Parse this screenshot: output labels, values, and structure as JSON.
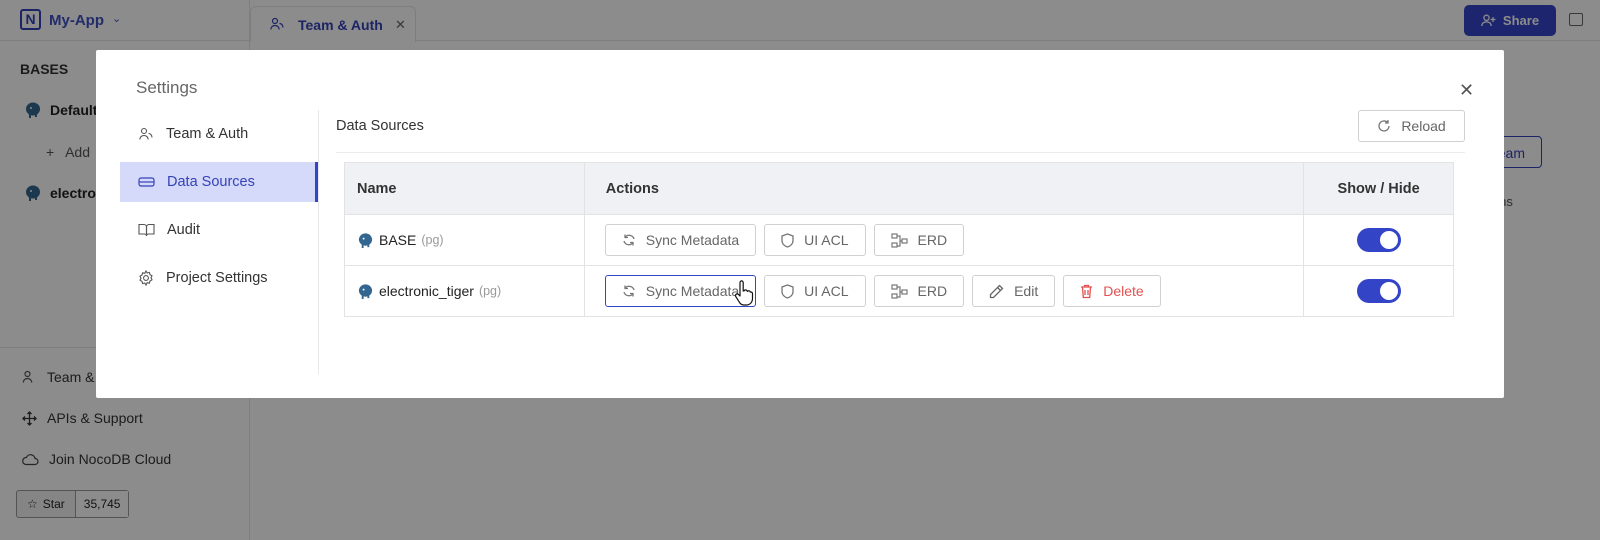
{
  "app": {
    "name": "My-App",
    "logo_letter": "N"
  },
  "tab": {
    "label": "Team & Auth"
  },
  "header": {
    "share_label": "Share"
  },
  "sidebar": {
    "bases_title": "BASES",
    "bases": [
      {
        "label": "Default"
      },
      {
        "label": "electro"
      }
    ],
    "add_label": "Add",
    "bottom_items": [
      {
        "label": "Team &"
      },
      {
        "label": "APIs & Support"
      },
      {
        "label": "Join NocoDB Cloud"
      }
    ],
    "star": {
      "label": "Star",
      "count": "35,745"
    }
  },
  "background": {
    "team_button": "eam",
    "actions_label": "ions"
  },
  "settings": {
    "title": "Settings",
    "nav": [
      {
        "label": "Team & Auth"
      },
      {
        "label": "Data Sources"
      },
      {
        "label": "Audit"
      },
      {
        "label": "Project Settings"
      }
    ],
    "active_nav": "Data Sources",
    "section_title": "Data Sources",
    "reload_label": "Reload",
    "table": {
      "columns": [
        "Name",
        "Actions",
        "Show / Hide"
      ],
      "rows": [
        {
          "name": "BASE",
          "type": "(pg)",
          "actions": [
            "Sync Metadata",
            "UI ACL",
            "ERD"
          ],
          "visible": true
        },
        {
          "name": "electronic_tiger",
          "type": "(pg)",
          "actions": [
            "Sync Metadata",
            "UI ACL",
            "ERD",
            "Edit",
            "Delete"
          ],
          "visible": true
        }
      ]
    }
  },
  "colors": {
    "accent": "#3444c6",
    "accent_light": "#d5d9fa",
    "danger": "#e25050"
  }
}
